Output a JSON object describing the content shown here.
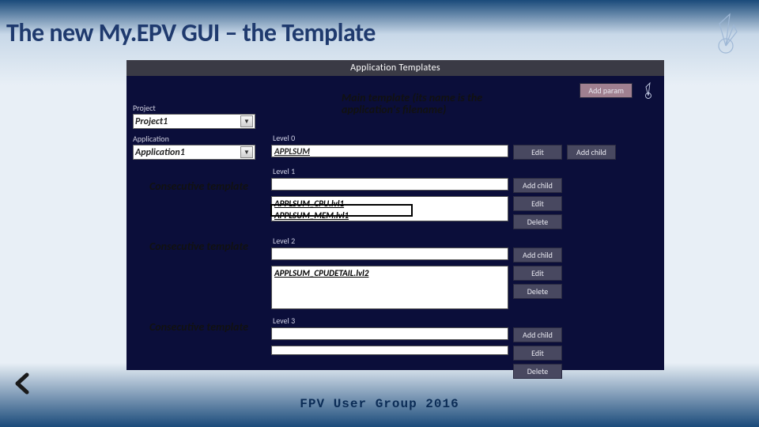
{
  "slide": {
    "title": "The new My.EPV GUI – the Template",
    "footer": "FPV User Group 2016"
  },
  "app": {
    "window_title": "Application Templates",
    "toolbar": {
      "add_param": "Add param"
    },
    "project": {
      "label": "Project",
      "value": "Project1"
    },
    "application": {
      "label": "Application",
      "value": "Application1"
    },
    "levels": {
      "l0": {
        "label": "Level 0",
        "value": "APPLSUM",
        "edit": "Edit",
        "add_child": "Add child"
      },
      "l1": {
        "label": "Level 1",
        "add_child": "Add child",
        "edit": "Edit",
        "delete": "Delete",
        "items": [
          "APPLSUM_CPU.lvl1",
          "APPLSUM_MEM.lvl1"
        ]
      },
      "l2": {
        "label": "Level 2",
        "add_child": "Add child",
        "edit": "Edit",
        "delete": "Delete",
        "items": [
          "APPLSUM_CPUDETAIL.lvl2"
        ]
      },
      "l3": {
        "label": "Level 3",
        "add_child": "Add child",
        "edit": "Edit",
        "delete": "Delete",
        "items": []
      }
    }
  },
  "annotations": {
    "main_template_l1": "Main template (its name is the",
    "main_template_l2": "application's filename)",
    "consecutive": "Consecutive template"
  }
}
